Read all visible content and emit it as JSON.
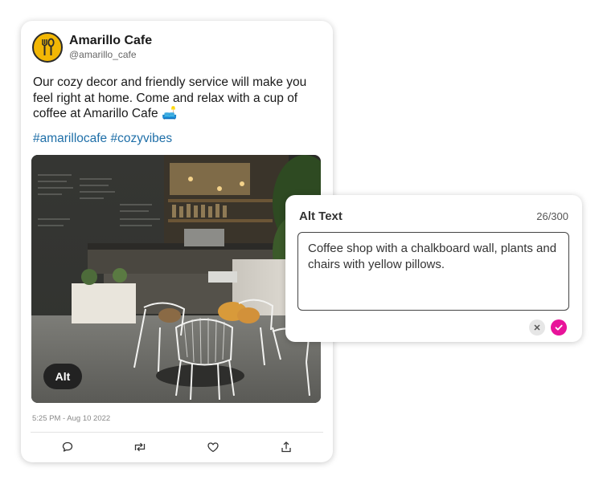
{
  "post": {
    "display_name": "Amarillo Cafe",
    "handle": "@amarillo_cafe",
    "text": "Our cozy decor and friendly service will make you feel right at home. Come and relax with a cup of coffee at Amarillo Cafe 🛋️",
    "hashtags": "#amarillocafe #cozyvibes",
    "alt_badge": "Alt",
    "timestamp": "5:25 PM - Aug 10 2022",
    "actions": [
      "comment-icon",
      "retweet-icon",
      "heart-icon",
      "share-icon"
    ]
  },
  "alt_panel": {
    "title": "Alt Text",
    "count": "26/300",
    "value": "Coffee shop with a chalkboard wall, plants and chairs with yellow pillows."
  },
  "colors": {
    "hashtag": "#1f6fa8",
    "confirm": "#e8139a",
    "avatar": "#f2b705"
  }
}
